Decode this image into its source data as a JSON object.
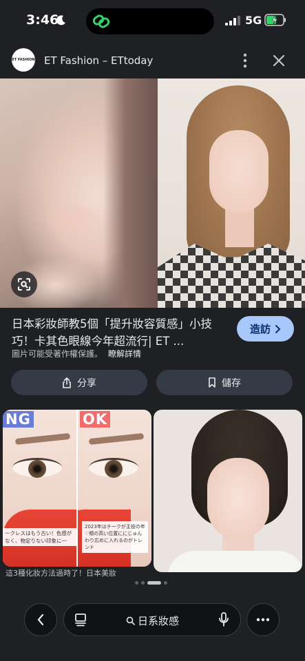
{
  "status": {
    "time": "3:46",
    "network": "5G"
  },
  "header": {
    "logo_text": "ET FASHION",
    "site": "ET Fashion – ETtoday"
  },
  "result": {
    "title": "日本彩妝師教5個「提升妝容質感」小技巧！卡其色眼線今年超流行| ET ...",
    "visit_label": "造訪",
    "copyright": "圖片可能受著作權保護。",
    "learn_more": "瞭解詳情"
  },
  "actions": {
    "share_label": "分享",
    "save_label": "儲存"
  },
  "related": {
    "ng_label": "NG",
    "ok_label": "OK",
    "ng_caption": "ークレスはもう古い！色感がなく、物足りない印象に一",
    "ok_caption": "2023年はチークが主役の年♡頬の高い位置ににじゅんわり広めに入れるのがトレンド",
    "caption_below": "這3種化妝方法過時了！日本美妝"
  },
  "bottom": {
    "query": "日系妝感"
  },
  "colors": {
    "background": "#1f2023",
    "visit_button": "#a8c7fa",
    "pill_button": "#353a47"
  }
}
